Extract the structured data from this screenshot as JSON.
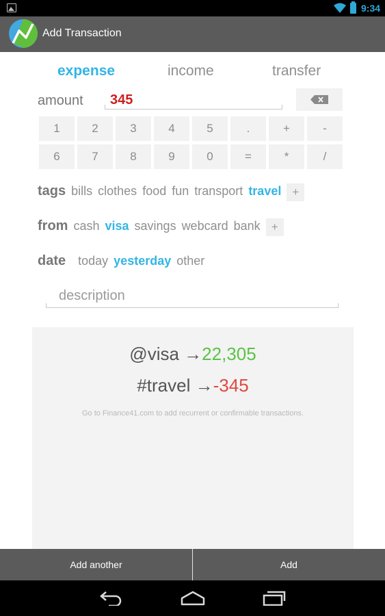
{
  "status_bar": {
    "time": "9:34",
    "accent": "#33b5e5"
  },
  "action_bar": {
    "title": "Add Transaction"
  },
  "type_tabs": [
    {
      "label": "expense",
      "selected": true
    },
    {
      "label": "income",
      "selected": false
    },
    {
      "label": "transfer",
      "selected": false
    }
  ],
  "amount": {
    "label": "amount",
    "value": "345",
    "value_color": "#cc1f1f"
  },
  "keypad": [
    [
      "1",
      "2",
      "3",
      "4",
      "5",
      ".",
      "+",
      "-"
    ],
    [
      "6",
      "7",
      "8",
      "9",
      "0",
      "=",
      "*",
      "/"
    ]
  ],
  "tags": {
    "label": "tags",
    "items": [
      "bills",
      "clothes",
      "food",
      "fun",
      "transport",
      "travel"
    ],
    "selected": "travel",
    "add": "+"
  },
  "from": {
    "label": "from",
    "items": [
      "cash",
      "visa",
      "savings",
      "webcard",
      "bank"
    ],
    "selected": "visa",
    "add": "+"
  },
  "date": {
    "label": "date",
    "items": [
      "today",
      "yesterday",
      "other"
    ],
    "selected": "yesterday"
  },
  "description": {
    "placeholder": "description"
  },
  "summary": {
    "line1_prefix": "@visa →",
    "line1_value": "22,305",
    "line2_prefix": "#travel →",
    "line2_value": "-345",
    "note": "Go to Finance41.com to add recurrent or confirmable transactions."
  },
  "buttons": {
    "add_another": "Add another",
    "add": "Add"
  },
  "icons": [
    "image-notification-icon",
    "wifi-icon",
    "battery-icon",
    "app-logo-icon",
    "backspace-icon",
    "back-icon",
    "home-icon",
    "recents-icon"
  ]
}
